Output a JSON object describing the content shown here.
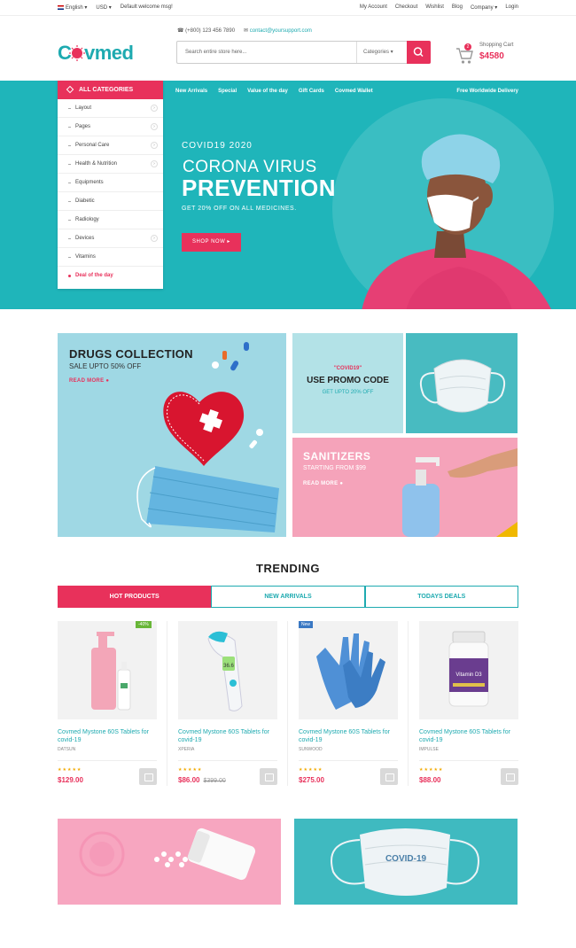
{
  "topbar": {
    "language": "English",
    "currency": "USD",
    "welcome": "Default welcome msg!",
    "links": [
      "My Account",
      "Checkout",
      "Wishlist",
      "Blog",
      "Company",
      "Login"
    ]
  },
  "header": {
    "logo": "Covmed",
    "phone": "(+800) 123 456 7890",
    "email": "contact@yoursupport.com",
    "search_placeholder": "Search entire store here...",
    "category_select": "Categories",
    "cart_label": "Shopping Cart",
    "cart_total": "$4580",
    "cart_count": "2"
  },
  "nav": {
    "all_categories": "ALL CATEGORIES",
    "links": [
      "New Arrivals",
      "Special",
      "Value of the day",
      "Gift Cards",
      "Covmed Wallet"
    ],
    "free_delivery": "Free Worldwide Delivery"
  },
  "categories": [
    "Layout",
    "Pages",
    "Personal Care",
    "Health & Nutrition",
    "Equipments",
    "Diabetic",
    "Radiology",
    "Devices",
    "Vitamins",
    "Deal of the day"
  ],
  "hero": {
    "subtitle": "COVID19 2020",
    "title_line1": "CORONA VIRUS",
    "title_line2": "PREVENTION",
    "offer": "GET 20% OFF ON ALL MEDICINES.",
    "cta": "SHOP NOW"
  },
  "banners": {
    "drugs": {
      "title": "DRUGS COLLECTION",
      "sub": "SALE UPTO 50% OFF",
      "link": "READ MORE"
    },
    "promo": {
      "code": "\"COVID19\"",
      "title": "USE PROMO CODE",
      "sub": "GET UPTO 20% OFF"
    },
    "sanitizers": {
      "title": "SANITIZERS",
      "sub": "STARTING FROM $99",
      "link": "READ MORE"
    }
  },
  "trending": {
    "title": "TRENDING",
    "tabs": [
      "HOT PRODUCTS",
      "NEW ARRIVALS",
      "TODAYS DEALS"
    ]
  },
  "products": [
    {
      "name": "Covmed Mystone 60S Tablets for covid-19",
      "brand": "DATSUN",
      "price": "$129.00",
      "old_price": "",
      "tag": "-40%"
    },
    {
      "name": "Covmed Mystone 60S Tablets for covid-19",
      "brand": "XPERIA",
      "price": "$86.00",
      "old_price": "$399.00",
      "tag": ""
    },
    {
      "name": "Covmed Mystone 60S Tablets for covid-19",
      "brand": "SUNWOOD",
      "price": "$275.00",
      "old_price": "",
      "tag": "New"
    },
    {
      "name": "Covmed Mystone 60S Tablets for covid-19",
      "brand": "IMPULSE",
      "price": "$88.00",
      "old_price": "",
      "tag": ""
    }
  ],
  "bottom_banner": {
    "mask_text": "COVID-19"
  },
  "vitamin_label": "Vitamin D3",
  "colors": {
    "primary": "#1eaab0",
    "accent": "#e8315b",
    "hero_bg": "#1fb5ba"
  }
}
